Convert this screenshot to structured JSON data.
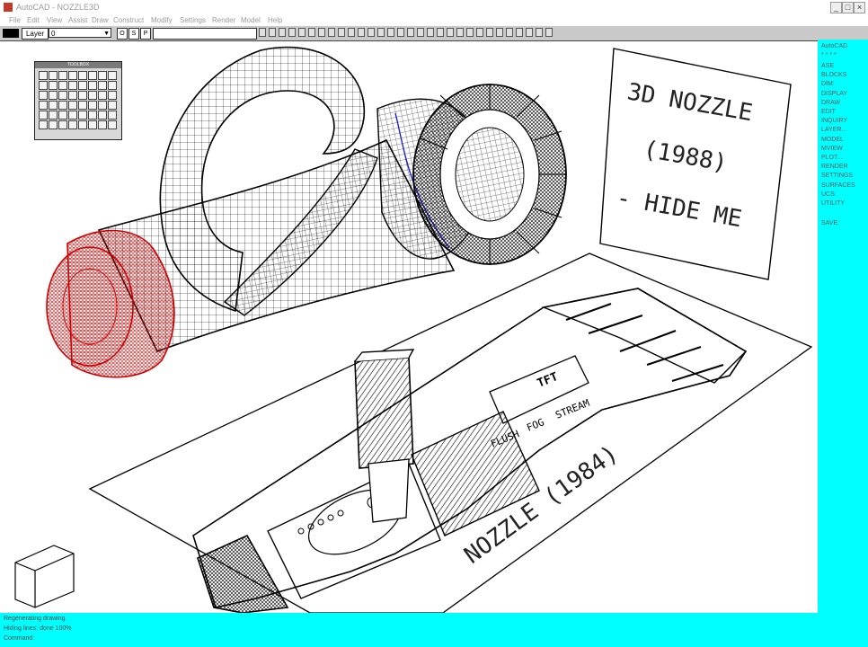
{
  "window": {
    "title": "AutoCAD - NOZZLE3D",
    "controls": [
      "_",
      "□",
      "×"
    ]
  },
  "menu": [
    "File",
    "Edit",
    "View",
    "Assist",
    "Draw",
    "Construct",
    "Modify",
    "Settings",
    "Render",
    "Model",
    "Help"
  ],
  "toolbar": {
    "color_swatch": "#000000",
    "layer_label": "Layer",
    "layer_value": "0",
    "small_buttons": [
      "O",
      "S",
      "P"
    ]
  },
  "palette": {
    "title": "TOOLBOX",
    "rows": 6,
    "cols": 8
  },
  "drawing": {
    "label_3d_line1": "3D NOZZLE",
    "label_3d_line2": "(1988)",
    "label_3d_line3": "- HIDE ME",
    "label_2d": "NOZZLE (1984)",
    "detail_text_1": "FLUSH",
    "detail_text_2": "FOG",
    "detail_text_3": "STREAM",
    "detail_logo": "TFT",
    "view_cube_icon": "3d-view-box"
  },
  "side_menu": {
    "header": "AutoCAD",
    "divider": "* * * *",
    "items": [
      "ASE",
      "BLOCKS",
      "DIM:",
      "DISPLAY",
      "DRAW",
      "EDIT",
      "INQUIRY",
      "LAYER...",
      "MODEL",
      "MVIEW",
      "PLOT...",
      "RENDER",
      "SETTINGS",
      "SURFACES",
      "UCS:",
      "UTILITY"
    ],
    "save": "SAVE:"
  },
  "command": {
    "lines": [
      "Regenerating drawing.",
      "Hiding lines: done 100%",
      "Command:"
    ]
  },
  "colors": {
    "accent": "#00ffff",
    "wire": "#000000",
    "wire_red": "#cc0000",
    "wire_blue": "#2222cc"
  }
}
